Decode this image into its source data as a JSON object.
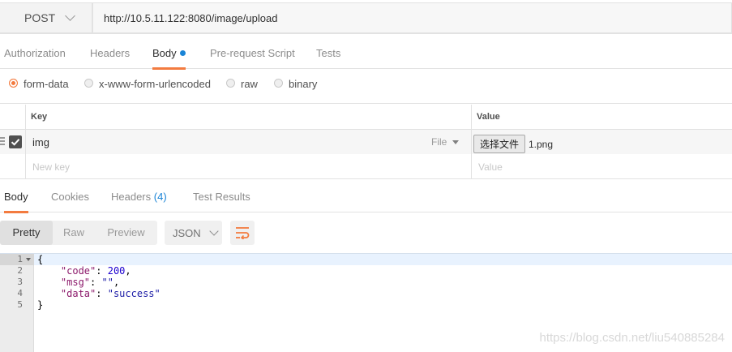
{
  "request": {
    "method": "POST",
    "url": "http://10.5.11.122:8080/image/upload"
  },
  "request_tabs": [
    {
      "label": "Authorization"
    },
    {
      "label": "Headers"
    },
    {
      "label": "Body",
      "active": true,
      "has_dot": true
    },
    {
      "label": "Pre-request Script"
    },
    {
      "label": "Tests"
    }
  ],
  "body_types": [
    {
      "label": "form-data",
      "selected": true
    },
    {
      "label": "x-www-form-urlencoded"
    },
    {
      "label": "raw"
    },
    {
      "label": "binary"
    }
  ],
  "form_table": {
    "headers": {
      "key": "Key",
      "value": "Value"
    },
    "rows": [
      {
        "checked": true,
        "key": "img",
        "type": "File",
        "choose_label": "选择文件",
        "file_name": "1.png"
      }
    ],
    "new_key_placeholder": "New key",
    "new_value_placeholder": "Value"
  },
  "response_tabs": [
    {
      "label": "Body",
      "active": true
    },
    {
      "label": "Cookies"
    },
    {
      "label": "Headers",
      "count": "(4)"
    },
    {
      "label": "Test Results"
    }
  ],
  "view_modes": [
    {
      "label": "Pretty",
      "active": true
    },
    {
      "label": "Raw"
    },
    {
      "label": "Preview"
    }
  ],
  "format": "JSON",
  "wrap_icon": "wrap-lines-icon",
  "response_body": {
    "line_numbers": [
      "1",
      "2",
      "3",
      "4",
      "5"
    ],
    "code": "200",
    "msg": "",
    "data": "success"
  },
  "watermark": "https://blog.csdn.net/liu540885284",
  "colors": {
    "accent": "#f37b3f",
    "blue": "#1a84d6"
  }
}
